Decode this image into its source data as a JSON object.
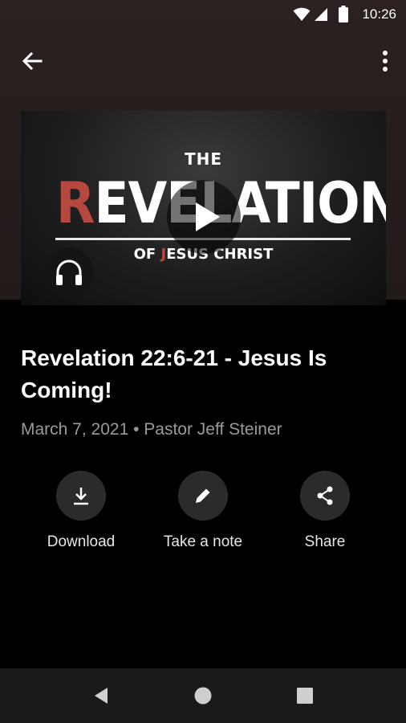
{
  "status_bar": {
    "time": "10:26"
  },
  "thumbnail": {
    "title_top": "THE",
    "title_first_letter": "R",
    "title_rest": "EVELATION",
    "subtitle_pre": "OF ",
    "subtitle_j": "J",
    "subtitle_post": "ESUS CHRIST"
  },
  "sermon": {
    "title": "Revelation 22:6-21 - Jesus Is Coming!",
    "meta": "March 7, 2021 • Pastor Jeff Steiner"
  },
  "actions": {
    "download_label": "Download",
    "note_label": "Take a note",
    "share_label": "Share"
  },
  "colors": {
    "accent_red": "#b5483f",
    "header_bg": "#2a2120",
    "button_bg": "#2b2b2b"
  }
}
